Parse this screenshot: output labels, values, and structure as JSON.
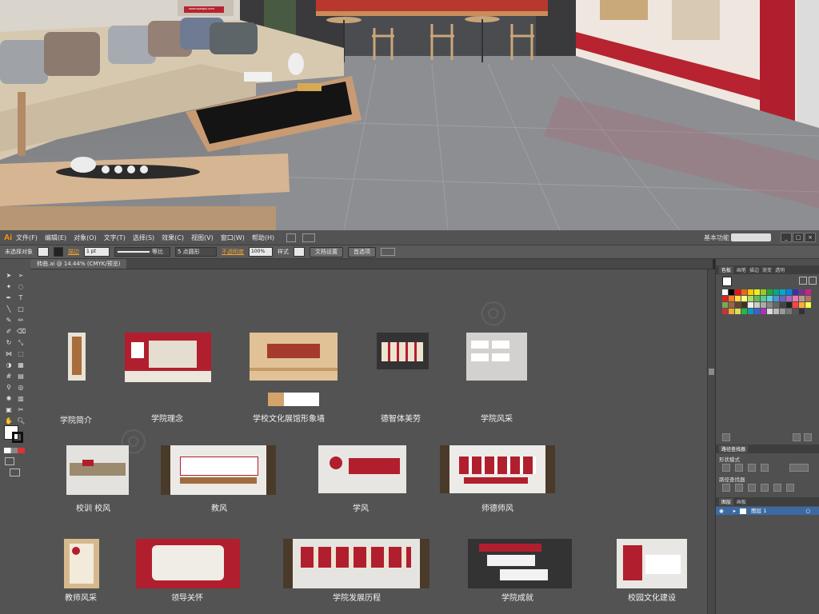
{
  "photo": {
    "site_sign": "www.ssanpic.com"
  },
  "app": {
    "logo": "Ai",
    "menu": [
      "文件(F)",
      "编辑(E)",
      "对象(O)",
      "文字(T)",
      "选择(S)",
      "效果(C)",
      "视图(V)",
      "窗口(W)",
      "帮助(H)"
    ],
    "workspace": "基本功能",
    "window_buttons": [
      "_",
      "□",
      "×"
    ]
  },
  "control_bar": {
    "selection": "未选择对象",
    "stroke_label": "描边",
    "stroke_value": "1 pt",
    "profile": "等比",
    "brush": "5 点圆形",
    "opacity_label": "不透明度",
    "opacity_value": "100%",
    "style_label": "样式",
    "doc_setup": "文档设置",
    "preferences": "首选项"
  },
  "document": {
    "tab": "转曲.ai @ 14.44% (CMYK/预览)"
  },
  "panels": {
    "swatches_tabs": [
      "色板",
      "画笔",
      "描边",
      "渐变",
      "透明"
    ],
    "pathfinder_title": "路径查找器",
    "shape_modes": "形状模式",
    "pathfinder_label": "路径查找器",
    "layers_tabs": [
      "图层",
      "画板"
    ],
    "layer_name": "图层 1",
    "colors": {
      "accent": "#b3202a",
      "selection": "#3b6aa3",
      "panel": "#505050"
    }
  },
  "artboards": [
    {
      "caption": "学院简介"
    },
    {
      "caption": "学院理念"
    },
    {
      "caption": "学校文化展馆形象墙"
    },
    {
      "caption": "德智体美劳"
    },
    {
      "caption": "学院风采"
    },
    {
      "caption": "校训 校风"
    },
    {
      "caption": "教风"
    },
    {
      "caption": "学风"
    },
    {
      "caption": "师德师风"
    },
    {
      "caption": "教师风采"
    },
    {
      "caption": "领导关怀"
    },
    {
      "caption": "学院发展历程"
    },
    {
      "caption": "学院成就"
    },
    {
      "caption": "校园文化建设"
    }
  ]
}
